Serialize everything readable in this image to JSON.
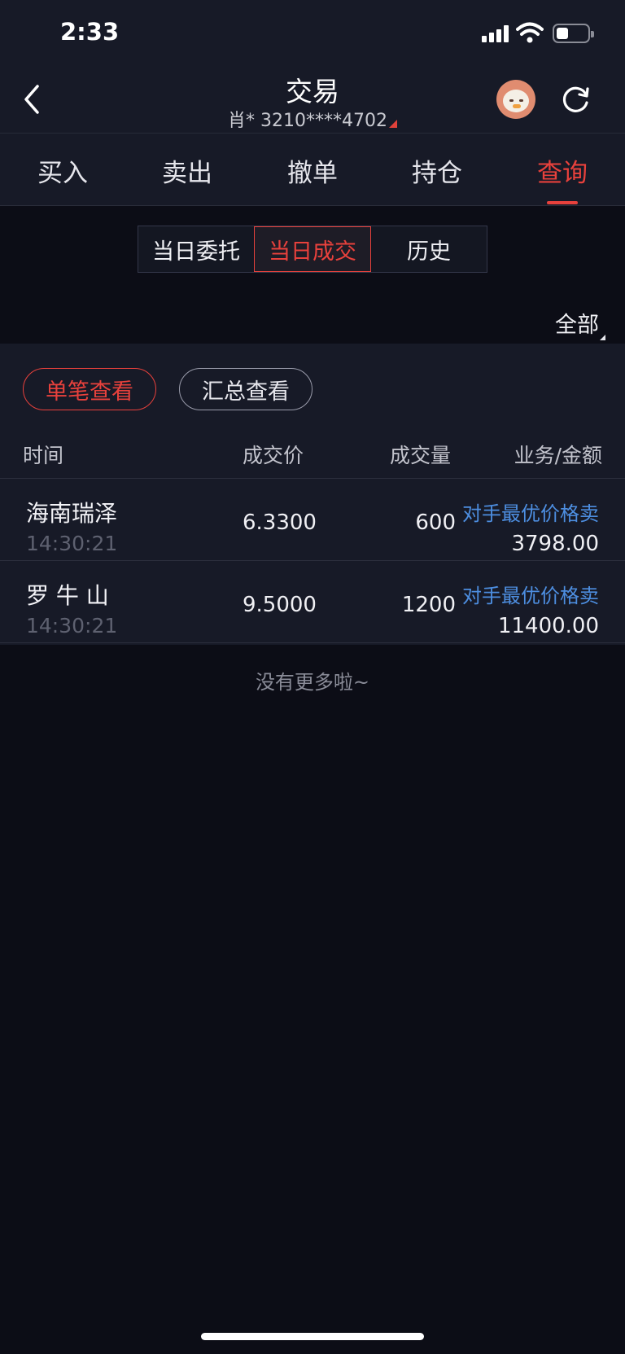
{
  "status": {
    "time": "2:33"
  },
  "header": {
    "title": "交易",
    "account": "肖* 3210****4702"
  },
  "tabs": [
    {
      "label": "买入"
    },
    {
      "label": "卖出"
    },
    {
      "label": "撤单"
    },
    {
      "label": "持仓"
    },
    {
      "label": "查询",
      "active": true
    }
  ],
  "segments": [
    {
      "label": "当日委托"
    },
    {
      "label": "当日成交",
      "active": true
    },
    {
      "label": "历史"
    }
  ],
  "filter": {
    "label": "全部"
  },
  "view_modes": [
    {
      "label": "单笔查看",
      "active": true
    },
    {
      "label": "汇总查看"
    }
  ],
  "table": {
    "headers": [
      "时间",
      "成交价",
      "成交量",
      "业务/金额"
    ],
    "rows": [
      {
        "name": "海南瑞泽",
        "time": "14:30:21",
        "price": "6.3300",
        "qty": "600",
        "business": "对手最优价格卖",
        "amount": "3798.00"
      },
      {
        "name": "罗 牛 山",
        "time": "14:30:21",
        "price": "9.5000",
        "qty": "1200",
        "business": "对手最优价格卖",
        "amount": "11400.00"
      }
    ]
  },
  "footer": {
    "no_more": "没有更多啦~"
  },
  "colors": {
    "accent": "#e8413c",
    "link": "#4d8ee0",
    "background": "#0c0d16",
    "panel": "#171a27"
  }
}
